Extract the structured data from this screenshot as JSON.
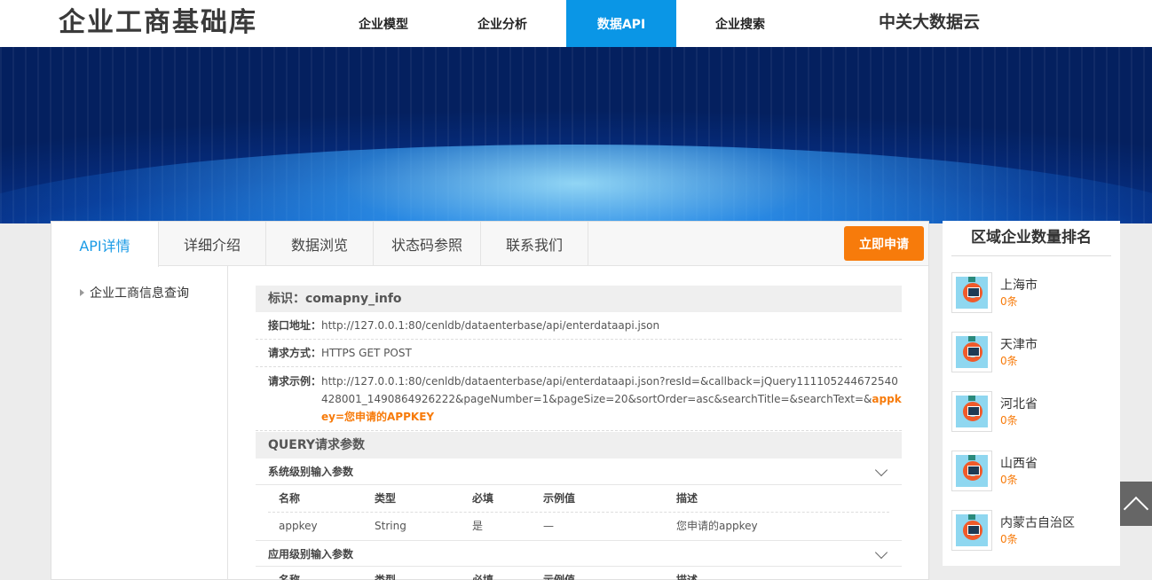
{
  "header": {
    "logo": "企业工商基础库",
    "nav": [
      "企业模型",
      "企业分析",
      "数据API",
      "企业搜索"
    ],
    "active_nav": 2,
    "brand": "中关大数据云"
  },
  "tabs": [
    "API详情",
    "详细介绍",
    "数据浏览",
    "状态码参照",
    "联系我们"
  ],
  "apply_button": "立即申请",
  "leftnav": {
    "item": "企业工商信息查询"
  },
  "api": {
    "id_label": "标识：comapny_info",
    "rows": [
      {
        "label": "接口地址：",
        "value": "http://127.0.0.1:80/cenldb/dataenterbase/api/enterdataapi.json"
      },
      {
        "label": "请求方式：",
        "value": "HTTPS GET POST"
      },
      {
        "label": "请求示例：",
        "value": "http://127.0.0.1:80/cenldb/dataenterbase/api/enterdataapi.json?resId=&callback=jQuery111105244672540428001_1490864926222&pageNumber=1&pageSize=20&sortOrder=asc&searchTitle=&searchText=&",
        "highlight": "appkey=您申请的APPKEY"
      }
    ],
    "query_head": "QUERY请求参数",
    "sys_params_head": "系统级别输入参数",
    "columns": [
      "名称",
      "类型",
      "必填",
      "示例值",
      "描述"
    ],
    "sys_params": [
      [
        "appkey",
        "String",
        "是",
        "—",
        "您申请的appkey"
      ]
    ],
    "app_params_head": "应用级别输入参数"
  },
  "sidebar": {
    "title": "区域企业数量排名",
    "items": [
      {
        "name": "上海市",
        "count": "0条"
      },
      {
        "name": "天津市",
        "count": "0条"
      },
      {
        "name": "河北省",
        "count": "0条"
      },
      {
        "name": "山西省",
        "count": "0条"
      },
      {
        "name": "内蒙古自治区",
        "count": "0条"
      }
    ]
  }
}
